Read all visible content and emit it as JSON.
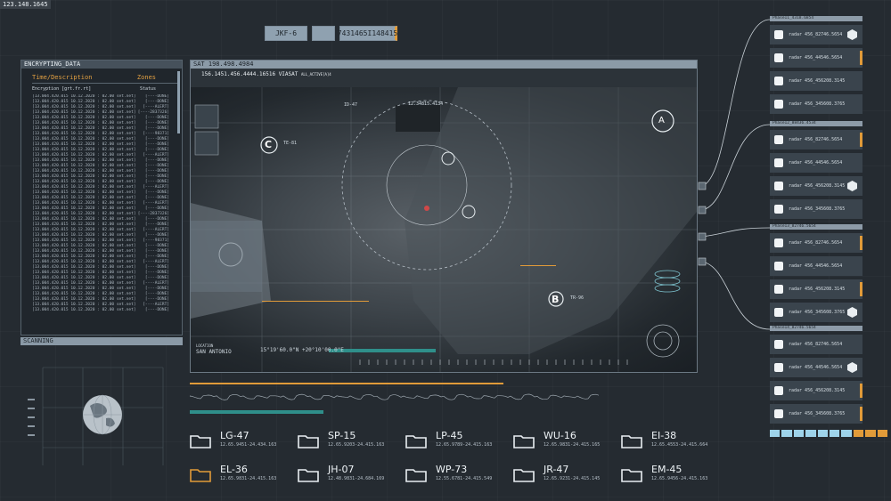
{
  "top_coordinate": "123.148.1645",
  "chips": {
    "a": "JKF-6",
    "b": "",
    "c": "7431465I148415"
  },
  "encrypting": {
    "title": "ENCRYPTING_DATA",
    "col1": "Time/Description",
    "col2": "Zones",
    "sub1": "Encryption [grt.fr.rt]",
    "sub2": "Status",
    "rows": [
      [
        "[13.004.420.015 10.12.2020 : 02.00 set.net]",
        "[----DONE]"
      ],
      [
        "[13.004.420.015 10.12.2020 : 02.00 set.net]",
        "[----DONE]"
      ],
      [
        "[13.004.420.015 10.12.2020 : 02.00 set.net]",
        "[----ALERT]"
      ],
      [
        "[13.004.420.015 10.12.2020 : 02.00 set.net]",
        "[----2837326]"
      ],
      [
        "[13.004.420.015 10.12.2020 : 02.00 set.net]",
        "[----DONE]"
      ],
      [
        "[13.004.420.015 10.12.2020 : 02.00 set.net]",
        "[----DONE]"
      ],
      [
        "[13.004.420.015 10.12.2020 : 02.00 set.net]",
        "[----DONE]"
      ],
      [
        "[13.004.420.015 10.12.2020 : 02.00 set.net]",
        "[----98371]"
      ],
      [
        "[13.004.420.015 10.12.2020 : 02.00 set.net]",
        "[----DONE]"
      ],
      [
        "[13.004.420.015 10.12.2020 : 02.00 set.net]",
        "[----DONE]"
      ],
      [
        "[13.004.420.015 10.12.2020 : 02.00 set.net]",
        "[----DONE]"
      ],
      [
        "[13.004.420.015 10.12.2020 : 02.00 set.net]",
        "[----ALERT]"
      ],
      [
        "[13.004.420.015 10.12.2020 : 02.00 set.net]",
        "[----DONE]"
      ],
      [
        "[13.004.420.015 10.12.2020 : 02.00 set.net]",
        "[----DONE]"
      ],
      [
        "[13.004.420.015 10.12.2020 : 02.00 set.net]",
        "[----DONE]"
      ],
      [
        "[13.004.420.015 10.12.2020 : 02.00 set.net]",
        "[----DONE]"
      ],
      [
        "[13.004.420.015 10.12.2020 : 02.00 set.net]",
        "[----DONE]"
      ],
      [
        "[13.004.420.015 10.12.2020 : 02.00 set.net]",
        "[----ALERT]"
      ],
      [
        "[13.004.420.015 10.12.2020 : 02.00 set.net]",
        "[----DONE]"
      ],
      [
        "[13.004.420.015 10.12.2020 : 02.00 set.net]",
        "[----DONE]"
      ],
      [
        "[13.004.420.015 10.12.2020 : 02.00 set.net]",
        "[----ALERT]"
      ],
      [
        "[13.004.420.015 10.12.2020 : 02.00 set.net]",
        "[----DONE]"
      ],
      [
        "[13.004.420.015 10.12.2020 : 02.00 set.net]",
        "[----2837326]"
      ],
      [
        "[13.004.420.015 10.12.2020 : 02.00 set.net]",
        "[----DONE]"
      ],
      [
        "[13.004.420.015 10.12.2020 : 02.00 set.net]",
        "[----DONE]"
      ],
      [
        "[13.004.420.015 10.12.2020 : 02.00 set.net]",
        "[----ALERT]"
      ],
      [
        "[13.004.420.015 10.12.2020 : 02.00 set.net]",
        "[----DONE]"
      ],
      [
        "[13.004.420.015 10.12.2020 : 02.00 set.net]",
        "[----98371]"
      ],
      [
        "[13.004.420.015 10.12.2020 : 02.00 set.net]",
        "[----DONE]"
      ],
      [
        "[13.004.420.015 10.12.2020 : 02.00 set.net]",
        "[----DONE]"
      ],
      [
        "[13.004.420.015 10.12.2020 : 02.00 set.net]",
        "[----DONE]"
      ],
      [
        "[13.004.420.015 10.12.2020 : 02.00 set.net]",
        "[----ALERT]"
      ],
      [
        "[13.004.420.015 10.12.2020 : 02.00 set.net]",
        "[----DONE]"
      ],
      [
        "[13.004.420.015 10.12.2020 : 02.00 set.net]",
        "[----DONE]"
      ],
      [
        "[13.004.420.015 10.12.2020 : 02.00 set.net]",
        "[----DONE]"
      ],
      [
        "[13.004.420.015 10.12.2020 : 02.00 set.net]",
        "[----ALERT]"
      ],
      [
        "[13.004.420.015 10.12.2020 : 02.00 set.net]",
        "[----DONE]"
      ],
      [
        "[13.004.420.015 10.12.2020 : 02.00 set.net]",
        "[----DONE]"
      ],
      [
        "[13.004.420.015 10.12.2020 : 02.00 set.net]",
        "[----DONE]"
      ],
      [
        "[13.004.420.015 10.12.2020 : 02.00 set.net]",
        "[----ALERT]"
      ],
      [
        "[13.004.420.015 10.12.2020 : 02.00 set.net]",
        "[----DONE]"
      ]
    ]
  },
  "scanning": {
    "title": "SCANNING"
  },
  "map": {
    "title": "SAT 198.498.4984",
    "subtitle": "156.1451.456.4444.16516 VIASAT",
    "subtitle_tag": "ALL_ACTIVE[A]4",
    "coords": "15°19'60.0\"N +20°10'00.0\"E",
    "location_label": "LOCATION",
    "location": "SAN ANTONIO",
    "tag_c": "TE-81",
    "tag_b": "TR-96",
    "letter_a": "A",
    "letter_b": "B",
    "letter_c": "C",
    "small_labels": [
      "ID-47",
      "12.34815.4134"
    ]
  },
  "right_panels": [
    {
      "title": "Phase11_4318.6854",
      "items": [
        {
          "label": "radar 456_82746.5654",
          "marker": "hex"
        },
        {
          "label": "radar 456_44546.5654",
          "marker": "orange"
        },
        {
          "label": "radar 456_456208.3145",
          "marker": "none"
        },
        {
          "label": "radar 456_345608.3765",
          "marker": "none"
        }
      ]
    },
    {
      "title": "Phase12_88436.4534",
      "items": [
        {
          "label": "radar 456_82746.5654",
          "marker": "orange"
        },
        {
          "label": "radar 456_44546.5654",
          "marker": "none"
        },
        {
          "label": "radar 456_456208.3145",
          "marker": "hex"
        },
        {
          "label": "radar 456_345608.3765",
          "marker": "none"
        }
      ]
    },
    {
      "title": "Phase13_82746.5654",
      "items": [
        {
          "label": "radar 456_82746.5654",
          "marker": "orange"
        },
        {
          "label": "radar 456_44546.5654",
          "marker": "none"
        },
        {
          "label": "radar 456_456208.3145",
          "marker": "orange"
        },
        {
          "label": "radar 456_345608.3765",
          "marker": "hex"
        }
      ]
    },
    {
      "title": "Phase14_82746.5654",
      "items": [
        {
          "label": "radar 456_82746.5654",
          "marker": "none"
        },
        {
          "label": "radar 456_44546.5654",
          "marker": "hex"
        },
        {
          "label": "radar 456_456208.3145",
          "marker": "orange"
        },
        {
          "label": "radar 456_345608.3765",
          "marker": "orange"
        }
      ]
    }
  ],
  "folders": [
    {
      "code": "LG-47",
      "coord": "12.65.9451-24.434.163",
      "highlight": false
    },
    {
      "code": "SP-15",
      "coord": "12.65.9203-24.415.163",
      "highlight": false
    },
    {
      "code": "LP-45",
      "coord": "12.65.9789-24.415.163",
      "highlight": false
    },
    {
      "code": "WU-16",
      "coord": "12.65.9831-24.415.165",
      "highlight": false
    },
    {
      "code": "EI-38",
      "coord": "12.65.4553-24.415.664",
      "highlight": false
    },
    {
      "code": "EL-36",
      "coord": "12.65.9831-24.415.163",
      "highlight": true
    },
    {
      "code": "JH-07",
      "coord": "12.48.9831-24.684.169",
      "highlight": false
    },
    {
      "code": "WP-73",
      "coord": "12.55.6781-24.415.549",
      "highlight": false
    },
    {
      "code": "JR-47",
      "coord": "12.65.9231-24.415.145",
      "highlight": false
    },
    {
      "code": "EM-45",
      "coord": "12.65.9456-24.415.163",
      "highlight": false
    }
  ],
  "colors": {
    "accent": "#e19b39",
    "teal": "#2f8f8a",
    "panel": "#3a444d"
  }
}
